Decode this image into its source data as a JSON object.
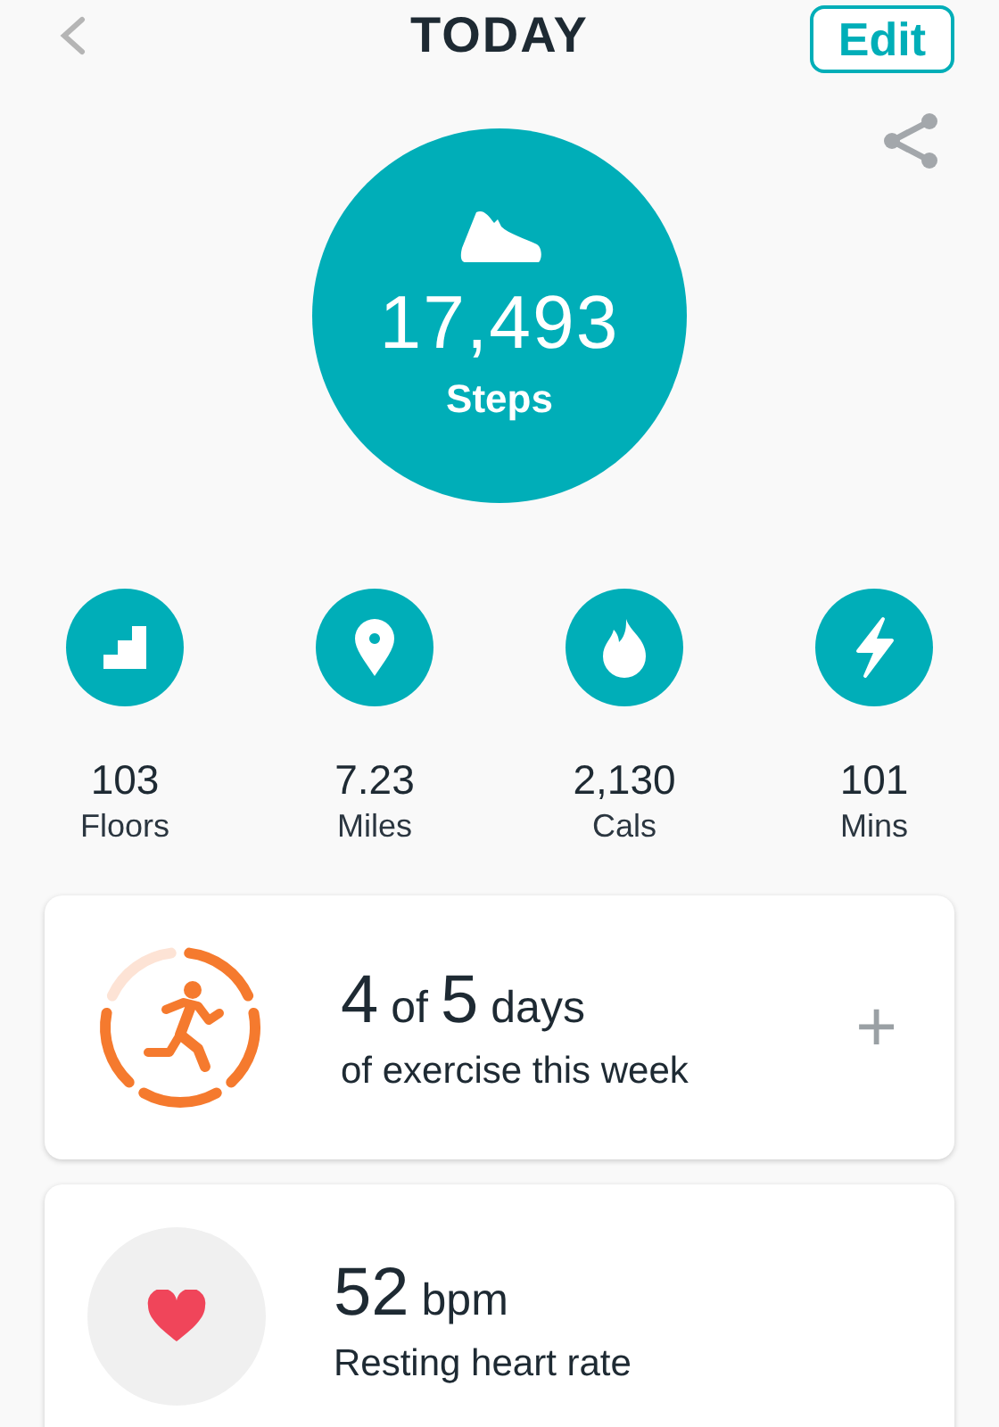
{
  "header": {
    "title": "TODAY",
    "edit_button": "Edit"
  },
  "steps": {
    "value": "17,493",
    "label": "Steps"
  },
  "stats": [
    {
      "kind": "floors",
      "value": "103",
      "label": "Floors"
    },
    {
      "kind": "distance",
      "value": "7.23",
      "label": "Miles"
    },
    {
      "kind": "calories",
      "value": "2,130",
      "label": "Cals"
    },
    {
      "kind": "minutes",
      "value": "101",
      "label": "Mins"
    }
  ],
  "exercise_card": {
    "headline": [
      {
        "kind": "number",
        "text": "4"
      },
      {
        "kind": "word",
        "text": "of"
      },
      {
        "kind": "number",
        "text": "5"
      },
      {
        "kind": "word",
        "text": "days"
      }
    ],
    "subtitle": "of exercise this week",
    "add_icon": "+",
    "ring_segments": [
      {
        "done": true
      },
      {
        "done": true
      },
      {
        "done": true
      },
      {
        "done": true
      },
      {
        "done": false
      }
    ]
  },
  "heart_card": {
    "headline": [
      {
        "kind": "number",
        "text": "52"
      },
      {
        "kind": "word",
        "text": "bpm"
      }
    ],
    "subtitle": "Resting heart rate"
  }
}
